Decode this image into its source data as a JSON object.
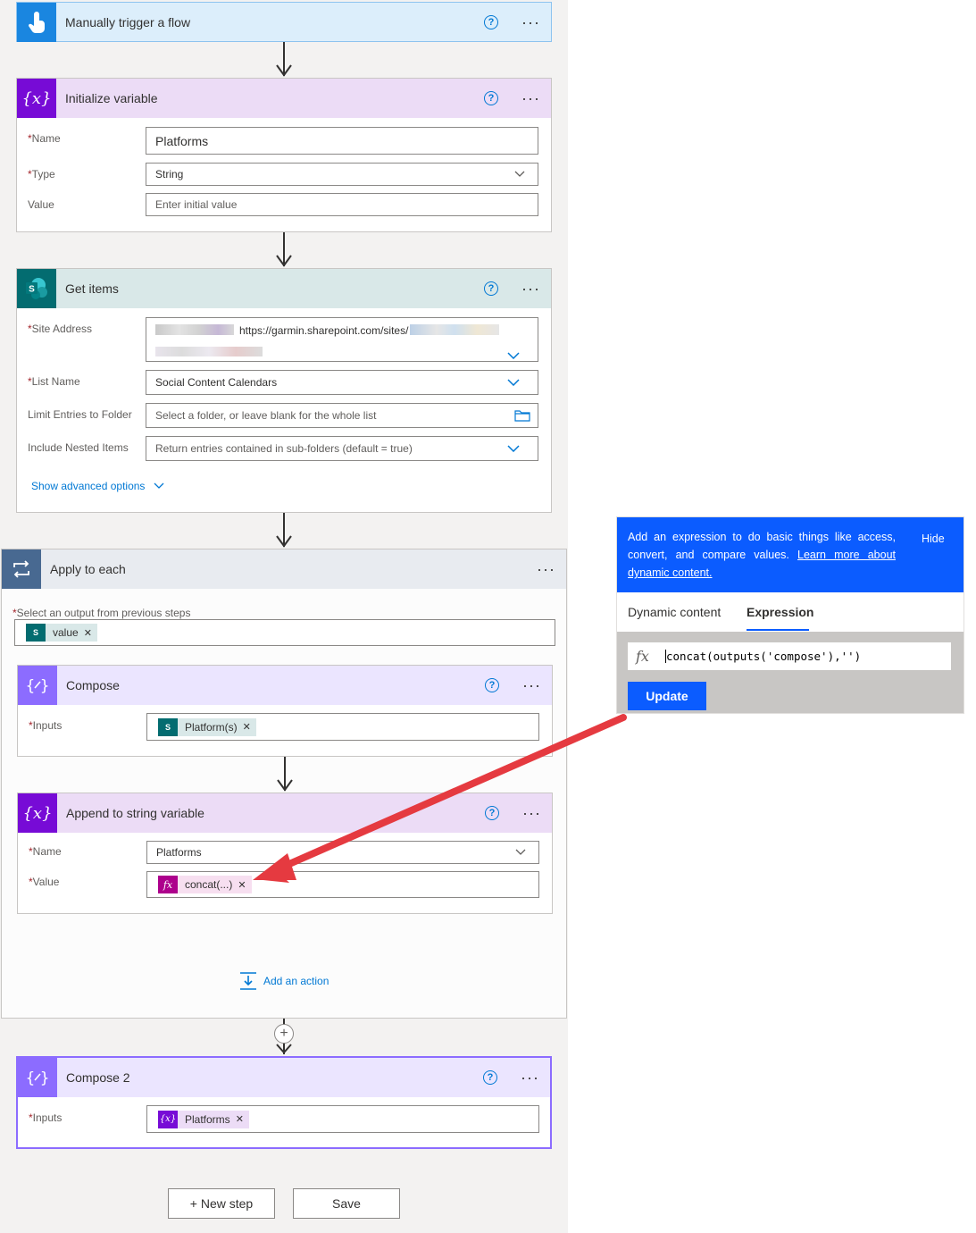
{
  "trigger": {
    "title": "Manually trigger a flow"
  },
  "init_var": {
    "title": "Initialize variable",
    "name_label": "Name",
    "name_value": "Platforms",
    "type_label": "Type",
    "type_value": "String",
    "value_label": "Value",
    "value_placeholder": "Enter initial value"
  },
  "get_items": {
    "title": "Get items",
    "site_label": "Site Address",
    "site_value": "https://garmin.sharepoint.com/sites/",
    "list_label": "List Name",
    "list_value": "Social Content Calendars",
    "folder_label": "Limit Entries to Folder",
    "folder_placeholder": "Select a folder, or leave blank for the whole list",
    "nested_label": "Include Nested Items",
    "nested_value": "Return entries contained in sub-folders (default = true)",
    "advanced_link": "Show advanced options"
  },
  "apply_each": {
    "title": "Apply to each",
    "select_label": "Select an output from previous steps",
    "token": "value",
    "add_action": "Add an action"
  },
  "compose": {
    "title": "Compose",
    "inputs_label": "Inputs",
    "token": "Platform(s)"
  },
  "append": {
    "title": "Append to string variable",
    "name_label": "Name",
    "name_value": "Platforms",
    "value_label": "Value",
    "token": "concat(...)"
  },
  "compose2": {
    "title": "Compose 2",
    "inputs_label": "Inputs",
    "token": "Platforms"
  },
  "footer": {
    "new_step": "+ New step",
    "save": "Save"
  },
  "expr_panel": {
    "info_text": "Add an expression to do basic things like access, convert, and compare values.",
    "learn_more": "Learn more about dynamic content.",
    "hide": "Hide",
    "tab_dynamic": "Dynamic content",
    "tab_expression": "Expression",
    "fx": "fx",
    "expression": "concat(outputs('compose'),'')",
    "update": "Update"
  },
  "colors": {
    "trigger_blue": "#0078d4",
    "variable_purple": "#770bd6",
    "sharepoint_teal": "#036c70",
    "compose_purple": "#8c6cff",
    "apply_slate": "#486991",
    "expression_magenta": "#ad008c",
    "panel_blue": "#0b5cff",
    "annotation_red": "#e53a40"
  }
}
